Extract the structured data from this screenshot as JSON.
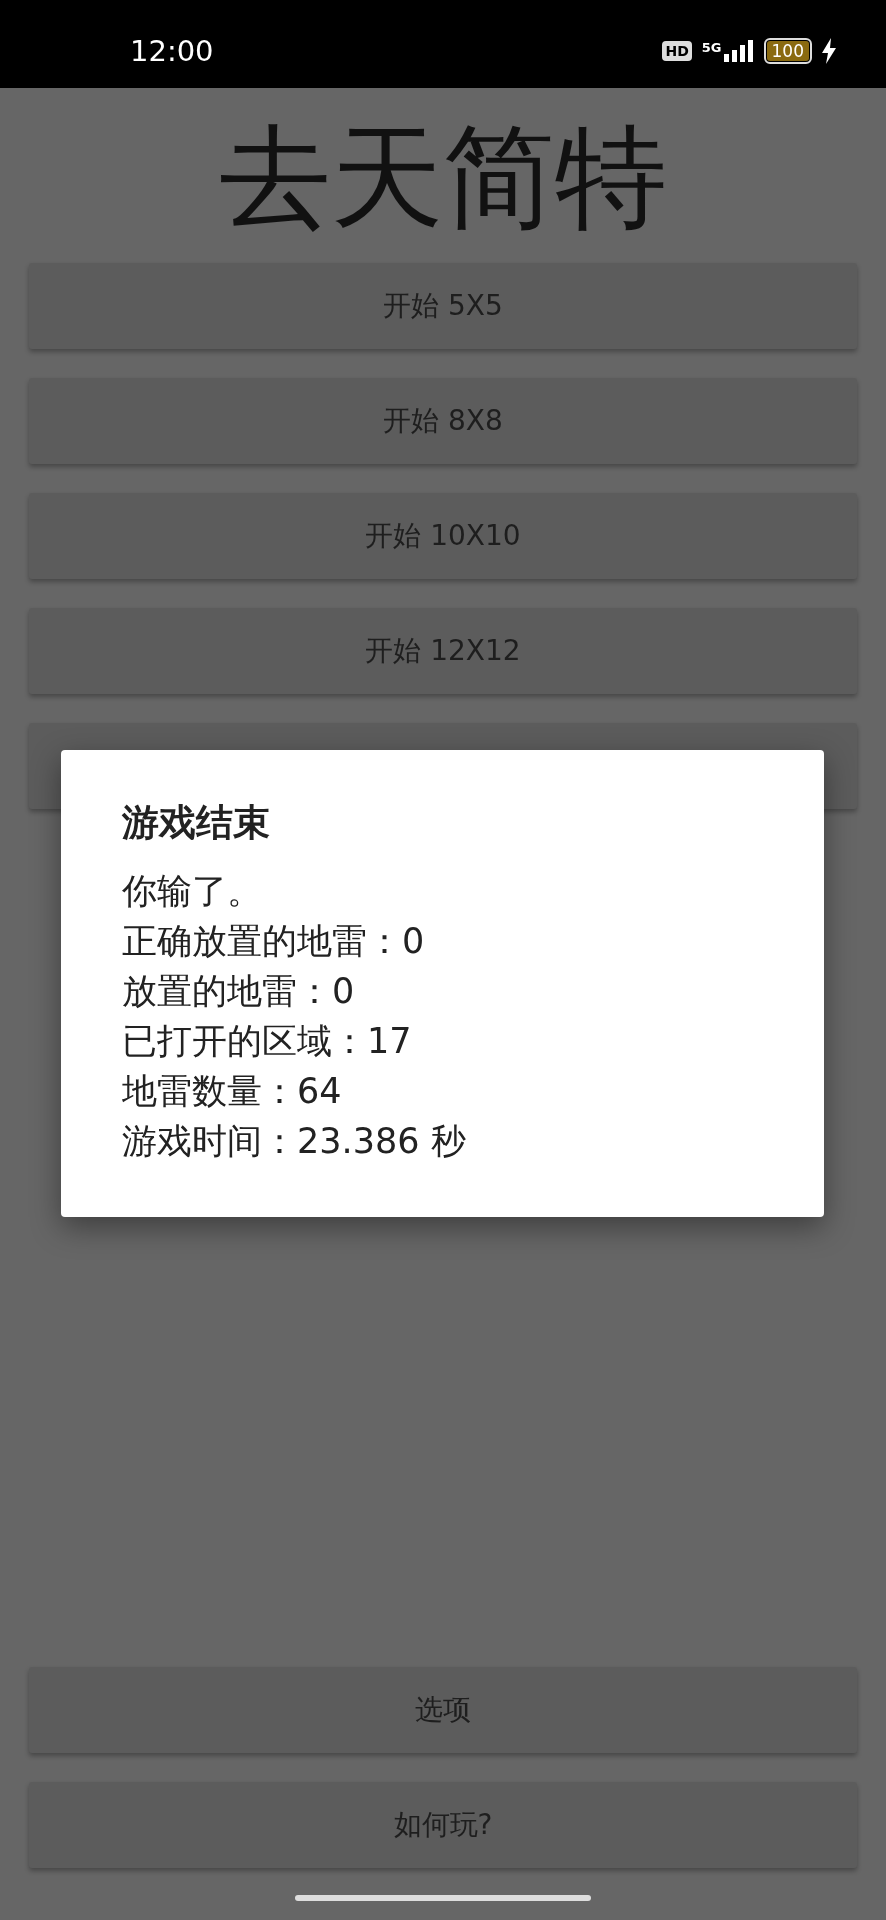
{
  "status_bar": {
    "time": "12:00",
    "hd_badge": "HD",
    "network": "5G",
    "battery": "100",
    "charging": true
  },
  "title": "去天简特",
  "menu_buttons": [
    {
      "label": "开始 5X5"
    },
    {
      "label": "开始 8X8"
    },
    {
      "label": "开始 10X10"
    },
    {
      "label": "开始 12X12"
    }
  ],
  "bottom_buttons": [
    {
      "label": "选项"
    },
    {
      "label": "如何玩?"
    }
  ],
  "dialog": {
    "title": "游戏结束",
    "lines": [
      "你输了。",
      "正确放置的地雷：0",
      "放置的地雷：0",
      "已打开的区域：17",
      "地雷数量：64",
      "游戏时间：23.386 秒"
    ]
  }
}
